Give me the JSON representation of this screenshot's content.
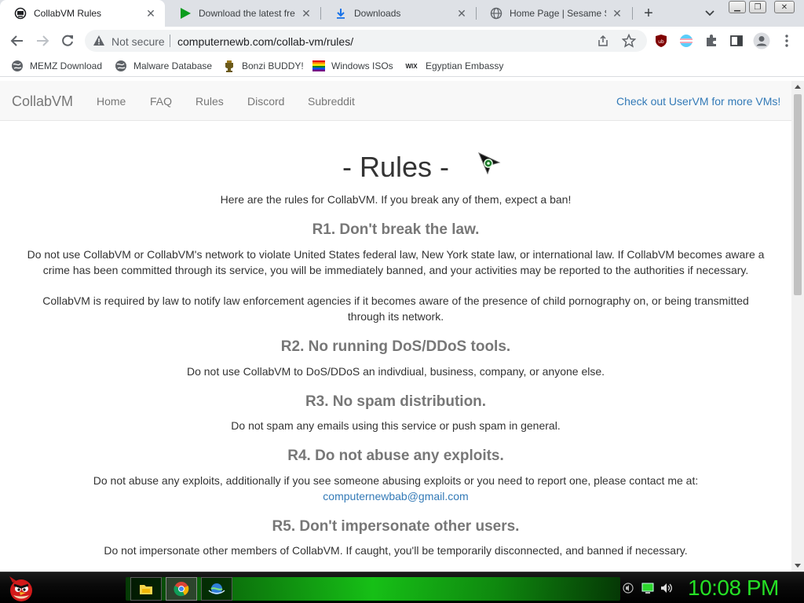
{
  "tabs": [
    {
      "title": "CollabVM Rules",
      "active": true,
      "icon": "collabvm-logo-icon"
    },
    {
      "title": "Download the latest free",
      "active": false,
      "icon": "green-play-icon"
    },
    {
      "title": "Downloads",
      "active": false,
      "icon": "download-icon"
    },
    {
      "title": "Home Page | Sesame Stre",
      "active": false,
      "icon": "globe-icon"
    }
  ],
  "tab_close_glyph": "✕",
  "new_tab_glyph": "+",
  "window_controls": {
    "minimize": "▁",
    "restore": "❐",
    "close": "✕"
  },
  "toolbar": {
    "security_label": "Not secure",
    "url": "computernewb.com/collab-vm/rules/"
  },
  "bookmarks": [
    {
      "label": "MEMZ Download",
      "icon": "globe-icon"
    },
    {
      "label": "Malware Database",
      "icon": "globe-icon"
    },
    {
      "label": "Bonzi BUDDY!",
      "icon": "trophy-icon"
    },
    {
      "label": "Windows ISOs",
      "icon": "rainbow-flag-icon"
    },
    {
      "label": "Egyptian Embassy",
      "icon": "wix-icon"
    }
  ],
  "wix_glyph": "WIX",
  "site_nav": {
    "brand": "CollabVM",
    "links": [
      "Home",
      "FAQ",
      "Rules",
      "Discord",
      "Subreddit"
    ],
    "right_link": "Check out UserVM for more VMs!"
  },
  "page": {
    "title": "- Rules -",
    "intro": "Here are the rules for CollabVM. If you break any of them, expect a ban!",
    "rules": [
      {
        "heading": "R1. Don't break the law.",
        "paragraphs": [
          "Do not use CollabVM or CollabVM's network to violate United States federal law, New York state law, or international law. If CollabVM becomes aware a crime has been committed through its service, you will be immediately banned, and your activities may be reported to the authorities if necessary.",
          "CollabVM is required by law to notify law enforcement agencies if it becomes aware of the presence of child pornography on, or being transmitted through its network."
        ]
      },
      {
        "heading": "R2. No running DoS/DDoS tools.",
        "paragraphs": [
          "Do not use CollabVM to DoS/DDoS an indivdiual, business, company, or anyone else."
        ]
      },
      {
        "heading": "R3. No spam distribution.",
        "paragraphs": [
          "Do not spam any emails using this service or push spam in general."
        ]
      },
      {
        "heading": "R4. Do not abuse any exploits.",
        "paragraphs": [
          "Do not abuse any exploits, additionally if you see someone abusing exploits or you need to report one, please contact me at:"
        ],
        "email": "computernewbab@gmail.com"
      },
      {
        "heading": "R5. Don't impersonate other users.",
        "paragraphs": [
          "Do not impersonate other members of CollabVM. If caught, you'll be temporarily disconnected, and banned if necessary."
        ]
      }
    ]
  },
  "taskbar": {
    "clock": "10:08 PM",
    "pinned": [
      "file-manager-icon",
      "chrome-icon",
      "network-globe-icon"
    ]
  },
  "colors": {
    "link_blue": "#337ab7",
    "heading_gray": "#777777",
    "clock_green": "#25e025",
    "ublock_red": "#800000"
  }
}
